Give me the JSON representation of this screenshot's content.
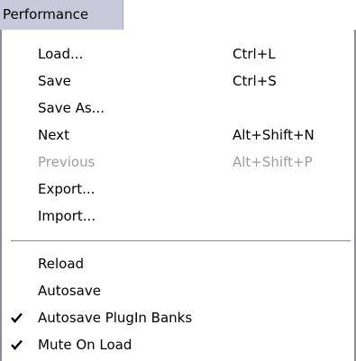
{
  "menubar": {
    "title": "Performance"
  },
  "menu": {
    "group1": [
      {
        "label": "Load...",
        "shortcut": "Ctrl+L",
        "enabled": true
      },
      {
        "label": "Save",
        "shortcut": "Ctrl+S",
        "enabled": true
      },
      {
        "label": "Save As...",
        "shortcut": "",
        "enabled": true
      },
      {
        "label": "Next",
        "shortcut": "Alt+Shift+N",
        "enabled": true
      },
      {
        "label": "Previous",
        "shortcut": "Alt+Shift+P",
        "enabled": false
      },
      {
        "label": "Export...",
        "shortcut": "",
        "enabled": true
      },
      {
        "label": "Import...",
        "shortcut": "",
        "enabled": true
      }
    ],
    "group2": [
      {
        "label": "Reload",
        "checked": false
      },
      {
        "label": "Autosave",
        "checked": false
      },
      {
        "label": "Autosave PlugIn Banks",
        "checked": true,
        "icon": "checkmark-icon"
      },
      {
        "label": "Mute On Load",
        "checked": true,
        "icon": "checkmark-icon"
      }
    ]
  },
  "colors": {
    "menubar_highlight": "#c9c9dc",
    "disabled_text": "#9d9d9d",
    "border": "#8d8d9a"
  }
}
